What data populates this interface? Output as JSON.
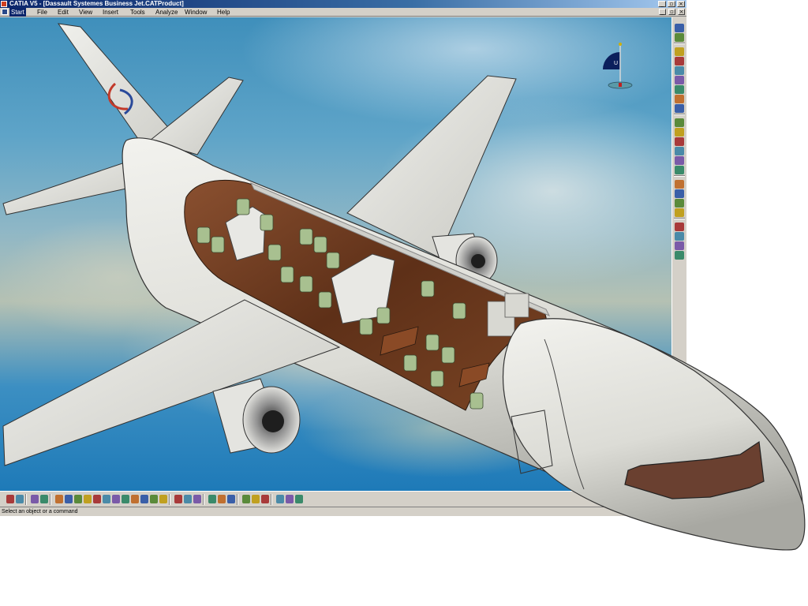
{
  "window": {
    "title": "CATIA V5 - [Dassault Systemes Business Jet.CATProduct]",
    "minimize_glyph": "_",
    "restore_glyph": "▫",
    "close_glyph": "×"
  },
  "menubar": {
    "items": [
      "Start",
      "File",
      "Edit",
      "View",
      "Insert",
      "Tools",
      "Analyze",
      "Window",
      "Help"
    ],
    "active": "Start"
  },
  "viewport": {
    "compass_label": "U",
    "tail_logo_text": "Dassault Systemes"
  },
  "right_toolbar": {
    "icons": [
      "sketcher-icon",
      "tools-icon",
      "snap-icon",
      "cube-icon",
      "sphere-icon",
      "render-icon",
      "globe-icon",
      "material-icon",
      "target-icon",
      "walk-icon",
      "fly-icon",
      "tree-icon",
      "shading-icon",
      "light-icon",
      "measure-icon",
      "clash-icon",
      "section-icon",
      "camera-icon",
      "capture-icon",
      "scene-icon",
      "animation-icon",
      "analysis-icon",
      "catalog-icon"
    ]
  },
  "bottom_toolbar": {
    "icons": [
      "select-icon",
      "lasso-icon",
      "table-icon",
      "tree-icon",
      "fit-all-icon",
      "pan-icon",
      "rotate-icon",
      "zoom-in-icon",
      "zoom-out-icon",
      "normal-view-icon",
      "multi-view-icon",
      "iso-view-icon",
      "shading-icon",
      "hide-show-icon",
      "swap-icon",
      "cut-icon",
      "paste-icon",
      "update-icon",
      "compass-icon",
      "fly-mode-icon",
      "magnifier-icon",
      "render-icon",
      "light-icon",
      "copy-icon",
      "wire-icon",
      "snapshot-icon",
      "measure-icon",
      "animate-icon"
    ]
  },
  "statusbar": {
    "text": "Select an object or a command"
  },
  "colors": {
    "titlebar": "#0a246a",
    "chrome": "#d4d0c8",
    "fuselage": "#e4e4e0",
    "wood": "#6b3e22",
    "seat": "#a8c090"
  }
}
